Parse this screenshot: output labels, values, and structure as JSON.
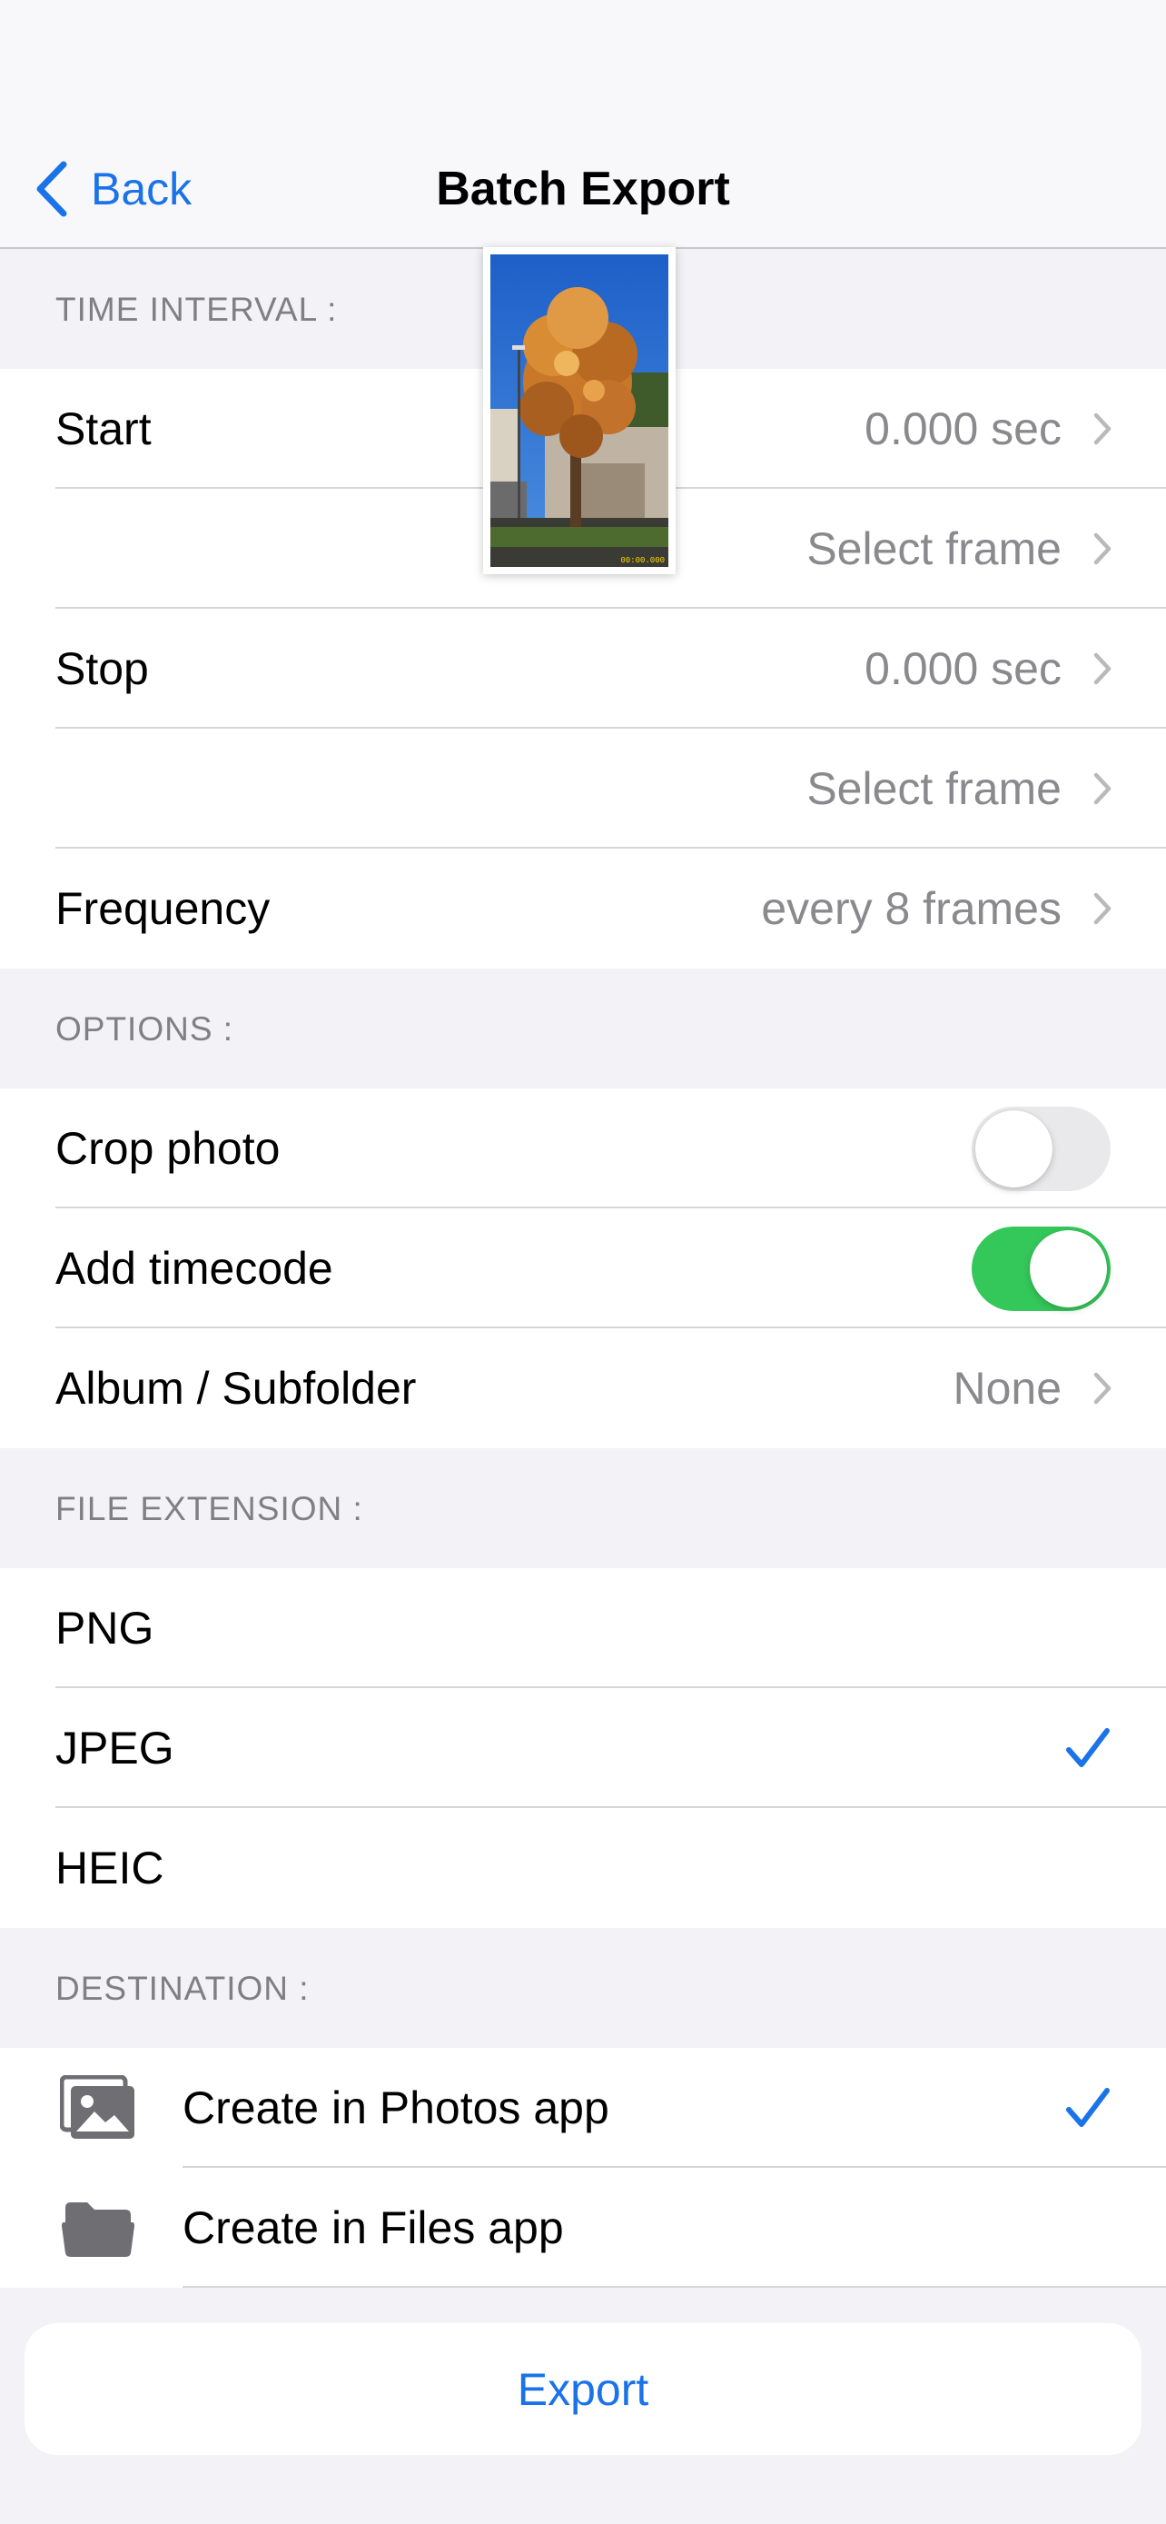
{
  "nav": {
    "back_label": "Back",
    "title": "Batch Export"
  },
  "time_interval": {
    "header": "TIME INTERVAL :",
    "start_label": "Start",
    "start_value": "0.000 sec",
    "start_frame": "Select frame",
    "stop_label": "Stop",
    "stop_value": "0.000 sec",
    "stop_frame": "Select frame",
    "frequency_label": "Frequency",
    "frequency_value": "every 8 frames"
  },
  "preview": {
    "timecode": "00:00.000"
  },
  "options": {
    "header": "OPTIONS :",
    "crop_label": "Crop photo",
    "crop_on": false,
    "timecode_label": "Add timecode",
    "timecode_on": true,
    "album_label": "Album / Subfolder",
    "album_value": "None"
  },
  "file_extension": {
    "header": "FILE EXTENSION :",
    "items": [
      "PNG",
      "JPEG",
      "HEIC"
    ],
    "selected": "JPEG"
  },
  "destination": {
    "header": "DESTINATION :",
    "photos_label": "Create in Photos app",
    "photos_icon": "photo-icon",
    "files_label": "Create in Files app",
    "files_icon": "folder-icon",
    "selected": "Create in Photos app"
  },
  "export_label": "Export",
  "colors": {
    "accent": "#1a73e8",
    "toggle_on": "#34c759"
  }
}
